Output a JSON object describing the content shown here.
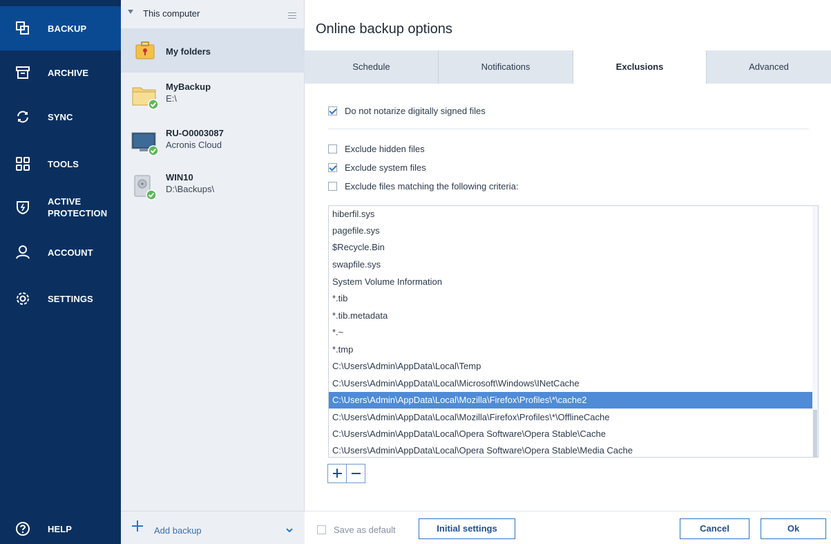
{
  "nav": {
    "items": [
      {
        "label": "BACKUP",
        "icon": "backup-icon",
        "active": true
      },
      {
        "label": "ARCHIVE",
        "icon": "archive-icon"
      },
      {
        "label": "SYNC",
        "icon": "sync-icon"
      },
      {
        "label": "TOOLS",
        "icon": "tools-icon"
      },
      {
        "label": "ACTIVE\nPROTECTION",
        "icon": "shield-icon"
      },
      {
        "label": "ACCOUNT",
        "icon": "account-icon"
      },
      {
        "label": "SETTINGS",
        "icon": "gear-icon"
      }
    ],
    "help_label": "HELP"
  },
  "backups": {
    "group_title": "This computer",
    "items": [
      {
        "name": "My folders",
        "sub": "",
        "icon": "briefcase-icon",
        "active": true
      },
      {
        "name": "MyBackup",
        "sub": "E:\\",
        "icon": "folder-icon"
      },
      {
        "name": "RU-O0003087",
        "sub": "Acronis Cloud",
        "icon": "computer-icon"
      },
      {
        "name": "WIN10",
        "sub": "D:\\Backups\\",
        "icon": "drive-icon"
      }
    ],
    "add_label": "Add backup"
  },
  "dialog": {
    "title": "Online backup options",
    "tabs": [
      "Schedule",
      "Notifications",
      "Exclusions",
      "Advanced"
    ],
    "active_tab": "Exclusions"
  },
  "exclusions": {
    "notarize_label": "Do not notarize digitally signed files",
    "notarize_checked": true,
    "hidden_label": "Exclude hidden files",
    "hidden_checked": false,
    "system_label": "Exclude system files",
    "system_checked": true,
    "criteria_label": "Exclude files matching the following criteria:",
    "criteria_checked": false,
    "criteria": [
      "hiberfil.sys",
      "pagefile.sys",
      "$Recycle.Bin",
      "swapfile.sys",
      "System Volume Information",
      "*.tib",
      "*.tib.metadata",
      "*.~",
      "*.tmp",
      "C:\\Users\\Admin\\AppData\\Local\\Temp",
      "C:\\Users\\Admin\\AppData\\Local\\Microsoft\\Windows\\INetCache",
      "C:\\Users\\Admin\\AppData\\Local\\Mozilla\\Firefox\\Profiles\\*\\cache2",
      "C:\\Users\\Admin\\AppData\\Local\\Mozilla\\Firefox\\Profiles\\*\\OfflineCache",
      "C:\\Users\\Admin\\AppData\\Local\\Opera Software\\Opera Stable\\Cache",
      "C:\\Users\\Admin\\AppData\\Local\\Opera Software\\Opera Stable\\Media Cache"
    ],
    "selected_index": 11
  },
  "footer": {
    "save_default_label": "Save as default",
    "initial_settings_label": "Initial settings",
    "cancel_label": "Cancel",
    "ok_label": "Ok"
  },
  "colors": {
    "nav_bg": "#0b3060",
    "nav_active": "#0a4a93",
    "accent": "#2b74c7",
    "selection": "#4f8bd6",
    "check_badge": "#5cb85c"
  }
}
